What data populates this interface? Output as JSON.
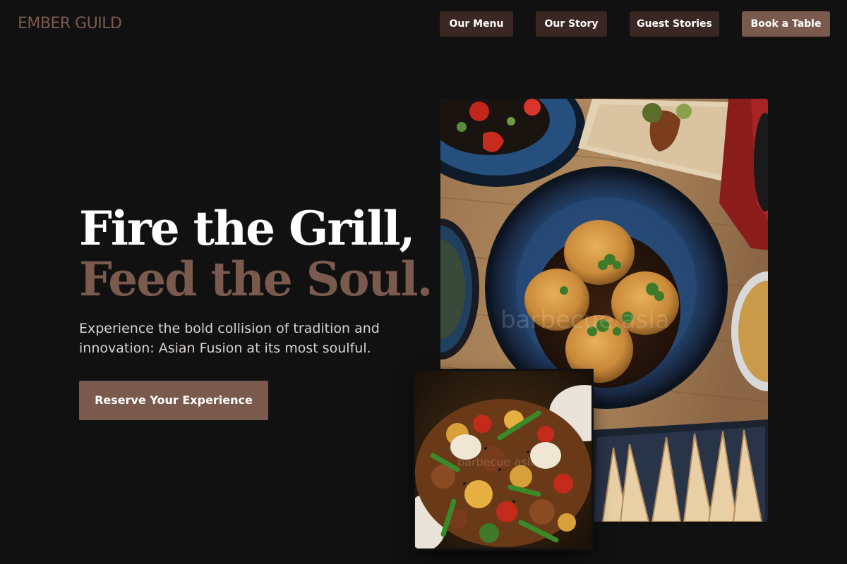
{
  "brand": {
    "logo_text": "EMBER GUILD"
  },
  "nav": {
    "menu_label": "Our Menu",
    "story_label": "Our Story",
    "guest_label": "Guest Stories",
    "book_label": "Book a Table"
  },
  "hero": {
    "title_line1": "Fire the Grill,",
    "title_line2": "Feed the Soul.",
    "subtitle": "Experience the bold collision of tradition and innovation: Asian Fusion at its most soulful.",
    "cta_label": "Reserve Your Experience"
  },
  "colors": {
    "background": "#111111",
    "accent": "#7a5a4d",
    "nav_button": "#3a2622",
    "text_primary": "#ffffff",
    "text_secondary": "#d9d4d0"
  },
  "images": {
    "main_photo_icon": "food-platter-photo",
    "secondary_photo_icon": "stir-fry-photo"
  }
}
